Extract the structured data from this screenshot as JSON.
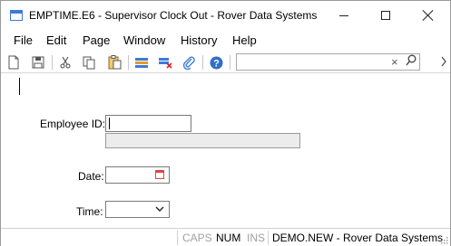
{
  "window": {
    "title": "EMPTIME.E6 - Supervisor Clock Out - Rover Data Systems"
  },
  "menu": {
    "items": [
      "File",
      "Edit",
      "Page",
      "Window",
      "History",
      "Help"
    ]
  },
  "toolbar": {
    "search_value": "",
    "search_clear_glyph": "×"
  },
  "form": {
    "employee_id_label": "Employee ID:",
    "employee_id_value": "",
    "employee_name_value": "",
    "date_label": "Date:",
    "date_value": "",
    "time_label": "Time:",
    "time_value": ""
  },
  "status": {
    "caps": "CAPS",
    "num": "NUM",
    "ins": "INS",
    "context": "DEMO.NEW - Rover Data Systems"
  },
  "colors": {
    "accent": "#3b7bd6",
    "disabled_text": "#a0a0a0",
    "readonly_bg": "#ececec"
  }
}
